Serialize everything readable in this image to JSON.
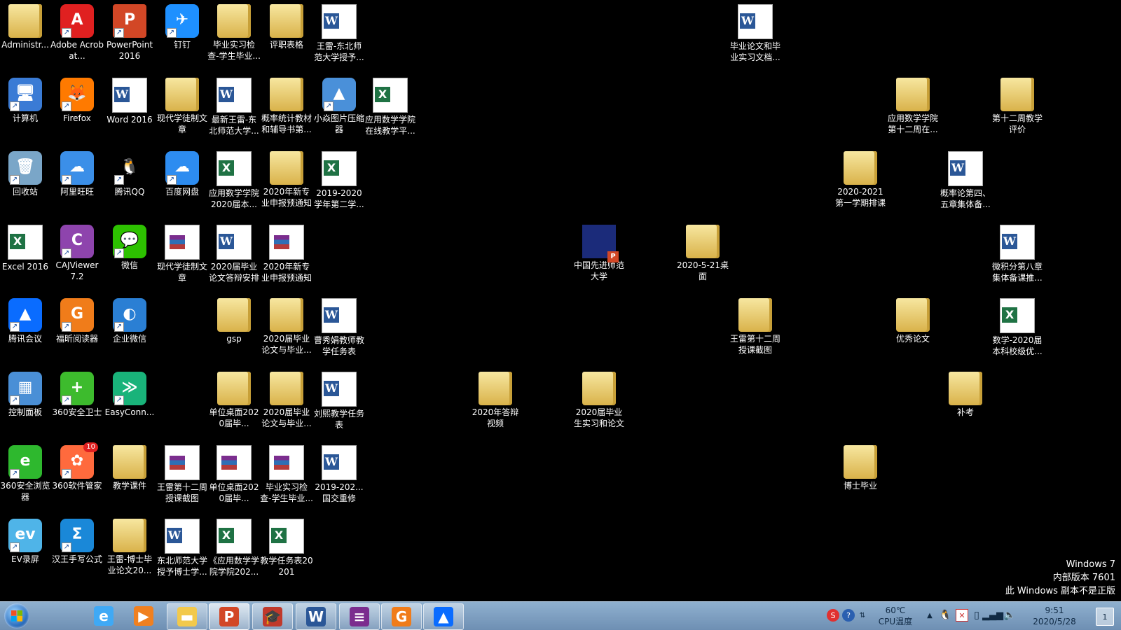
{
  "desktop": {
    "icons": [
      {
        "label": "Administr...",
        "type": "folder"
      },
      {
        "label": "Adobe Acrobat...",
        "type": "app",
        "glyph": "A",
        "color": "#e02020"
      },
      {
        "label": "PowerPoint 2016",
        "type": "ppt",
        "glyph": "P"
      },
      {
        "label": "钉钉",
        "type": "app",
        "glyph": "✈",
        "color": "#1e90ff"
      },
      {
        "label": "毕业实习检查-学生毕业...",
        "type": "folder"
      },
      {
        "label": "评职表格",
        "type": "folder"
      },
      {
        "label": "王雷-东北师范大学授予...",
        "type": "word"
      },
      {
        "label": "毕业论文和毕业实习文档...",
        "type": "word"
      },
      {
        "label": "计算机",
        "type": "app",
        "glyph": "🖥",
        "color": "#3a7bd5"
      },
      {
        "label": "Firefox",
        "type": "app",
        "glyph": "🦊",
        "color": "#ff7a00"
      },
      {
        "label": "Word 2016",
        "type": "word"
      },
      {
        "label": "现代学徒制文章",
        "type": "folder"
      },
      {
        "label": "最新王雷-东北师范大学...",
        "type": "word"
      },
      {
        "label": "概率统计教材和辅导书第...",
        "type": "folder"
      },
      {
        "label": "小焱图片压缩器",
        "type": "app",
        "glyph": "▲",
        "color": "#4a90d9"
      },
      {
        "label": "应用数学学院在线教学平...",
        "type": "excel"
      },
      {
        "label": "应用数学学院第十二周在...",
        "type": "folder"
      },
      {
        "label": "第十二周教学评价",
        "type": "folder"
      },
      {
        "label": "回收站",
        "type": "app",
        "glyph": "🗑",
        "color": "#7aa6c8"
      },
      {
        "label": "阿里旺旺",
        "type": "app",
        "glyph": "☁",
        "color": "#3b8fe8"
      },
      {
        "label": "腾讯QQ",
        "type": "app",
        "glyph": "🐧",
        "color": "#000000"
      },
      {
        "label": "百度网盘",
        "type": "app",
        "glyph": "☁",
        "color": "#2d8cf0"
      },
      {
        "label": "应用数学学院2020届本...",
        "type": "excel"
      },
      {
        "label": "2020年新专业申报预通知",
        "type": "folder"
      },
      {
        "label": "2019-2020学年第二学...",
        "type": "excel"
      },
      {
        "label": "2020-2021第一学期排课",
        "type": "folder"
      },
      {
        "label": "概率论第四、五章集体备...",
        "type": "word"
      },
      {
        "label": "Excel 2016",
        "type": "excel"
      },
      {
        "label": "CAJViewer 7.2",
        "type": "app",
        "glyph": "C",
        "color": "#8e44ad"
      },
      {
        "label": "微信",
        "type": "app",
        "glyph": "💬",
        "color": "#2dc100"
      },
      {
        "label": "现代学徒制文章",
        "type": "rar"
      },
      {
        "label": "2020届毕业论文答辩安排",
        "type": "word"
      },
      {
        "label": "2020年新专业申报预通知",
        "type": "rar"
      },
      {
        "label": "中国先进师范大学",
        "type": "ppt2"
      },
      {
        "label": "2020-5-21桌面",
        "type": "folder"
      },
      {
        "label": "微积分第八章集体备课推...",
        "type": "word"
      },
      {
        "label": "腾讯会议",
        "type": "app",
        "glyph": "▲",
        "color": "#0a6cff"
      },
      {
        "label": "福昕阅读器",
        "type": "app",
        "glyph": "G",
        "color": "#f07c1a"
      },
      {
        "label": "企业微信",
        "type": "app",
        "glyph": "◐",
        "color": "#2a7fd4"
      },
      {
        "label": "gsp",
        "type": "folder"
      },
      {
        "label": "2020届毕业论文与毕业...",
        "type": "folder"
      },
      {
        "label": "曹秀娟教师教学任务表",
        "type": "word"
      },
      {
        "label": "王雷第十二周授课截图",
        "type": "folder"
      },
      {
        "label": "优秀论文",
        "type": "folder"
      },
      {
        "label": "数学-2020届本科校级优...",
        "type": "excel"
      },
      {
        "label": "控制面板",
        "type": "app",
        "glyph": "▦",
        "color": "#4a8fd6"
      },
      {
        "label": "360安全卫士",
        "type": "app",
        "glyph": "+",
        "color": "#3dbb2d"
      },
      {
        "label": "EasyConn...",
        "type": "app",
        "glyph": "≫",
        "color": "#19b37a"
      },
      {
        "label": "单位桌面2020届毕...",
        "type": "folder"
      },
      {
        "label": "2020届毕业论文与毕业...",
        "type": "folder"
      },
      {
        "label": "刘熙教学任务表",
        "type": "word"
      },
      {
        "label": "2020年答辩视频",
        "type": "folder"
      },
      {
        "label": "2020届毕业生实习和论文",
        "type": "folder"
      },
      {
        "label": "补考",
        "type": "folder"
      },
      {
        "label": "360安全浏览器",
        "type": "app",
        "glyph": "e",
        "color": "#2eb82e"
      },
      {
        "label": "360软件管家",
        "type": "app",
        "glyph": "✿",
        "color": "#ff6a3d"
      },
      {
        "label": "教学课件",
        "type": "folder"
      },
      {
        "label": "王雷第十二周授课截图",
        "type": "rar"
      },
      {
        "label": "单位桌面2020届毕...",
        "type": "rar"
      },
      {
        "label": "毕业实习检查-学生毕业...",
        "type": "rar"
      },
      {
        "label": "2019-202...国交重修",
        "type": "word"
      },
      {
        "label": "博士毕业",
        "type": "folder"
      },
      {
        "label": "EV录屏",
        "type": "app",
        "glyph": "ev",
        "color": "#4fb4e8"
      },
      {
        "label": "汉王手写公式",
        "type": "app",
        "glyph": "Σ",
        "color": "#1a88d8"
      },
      {
        "label": "王雷-博士毕业论文20...",
        "type": "folder"
      },
      {
        "label": "东北师范大学授予博士学...",
        "type": "word"
      },
      {
        "label": "《应用数学学院学院202...",
        "type": "excel"
      },
      {
        "label": "教学任务表20201",
        "type": "excel"
      }
    ],
    "badge_360": "10"
  },
  "watermark": {
    "line1": "Windows 7",
    "line2": "内部版本 7601",
    "line3": "此 Windows 副本不是正版"
  },
  "taskbar": {
    "items": [
      {
        "name": "ie",
        "glyph": "e",
        "color": "#3fa9f5"
      },
      {
        "name": "media-player",
        "glyph": "▶",
        "color": "#f08020"
      },
      {
        "name": "explorer",
        "glyph": "▬",
        "color": "#f2c94c"
      },
      {
        "name": "powerpoint",
        "glyph": "P",
        "color": "#d24726"
      },
      {
        "name": "graduation-app",
        "glyph": "🎓",
        "color": "#c0392b"
      },
      {
        "name": "word",
        "glyph": "W",
        "color": "#2b5797"
      },
      {
        "name": "winrar",
        "glyph": "≡",
        "color": "#7b2d8e"
      },
      {
        "name": "foxit",
        "glyph": "G",
        "color": "#f07c1a"
      },
      {
        "name": "tencent-meeting",
        "glyph": "▲",
        "color": "#0a6cff"
      }
    ],
    "temp": "60℃",
    "temp_label": "CPU温度",
    "time": "9:51",
    "date": "2020/5/28"
  }
}
